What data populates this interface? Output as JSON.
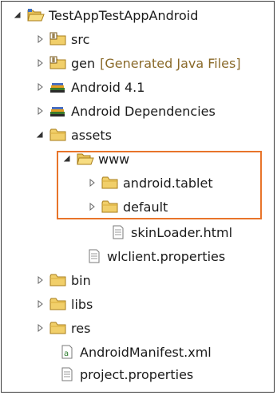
{
  "tree": {
    "items": [
      {
        "label": "TestAppTestAppAndroid",
        "decoration": "",
        "icon": "project-folder-icon",
        "expander": "expanded"
      },
      {
        "label": "src",
        "decoration": "",
        "icon": "source-folder-icon",
        "expander": "collapsed"
      },
      {
        "label": "gen",
        "decoration": "[Generated Java Files]",
        "icon": "source-folder-icon",
        "expander": "collapsed"
      },
      {
        "label": "Android 4.1",
        "decoration": "",
        "icon": "library-icon",
        "expander": "collapsed"
      },
      {
        "label": "Android Dependencies",
        "decoration": "",
        "icon": "library-icon",
        "expander": "collapsed"
      },
      {
        "label": "assets",
        "decoration": "",
        "icon": "folder-icon",
        "expander": "expanded"
      },
      {
        "label": "www",
        "decoration": "",
        "icon": "folder-open-icon",
        "expander": "expanded"
      },
      {
        "label": "android.tablet",
        "decoration": "",
        "icon": "folder-icon",
        "expander": "collapsed"
      },
      {
        "label": "default",
        "decoration": "",
        "icon": "folder-icon",
        "expander": "collapsed"
      },
      {
        "label": "skinLoader.html",
        "decoration": "",
        "icon": "file-icon",
        "expander": "none"
      },
      {
        "label": "wlclient.properties",
        "decoration": "",
        "icon": "file-icon",
        "expander": "none"
      },
      {
        "label": "bin",
        "decoration": "",
        "icon": "folder-icon",
        "expander": "collapsed"
      },
      {
        "label": "libs",
        "decoration": "",
        "icon": "folder-icon",
        "expander": "collapsed"
      },
      {
        "label": "res",
        "decoration": "",
        "icon": "folder-icon",
        "expander": "collapsed"
      },
      {
        "label": "AndroidManifest.xml",
        "decoration": "",
        "icon": "xml-file-icon",
        "expander": "none"
      },
      {
        "label": "project.properties",
        "decoration": "",
        "icon": "file-icon",
        "expander": "none"
      }
    ]
  },
  "colors": {
    "highlight_border": "#e8742a",
    "folder": "#e8c35a",
    "decoration_text": "#8a6a2a",
    "text": "#1a1a1a"
  }
}
